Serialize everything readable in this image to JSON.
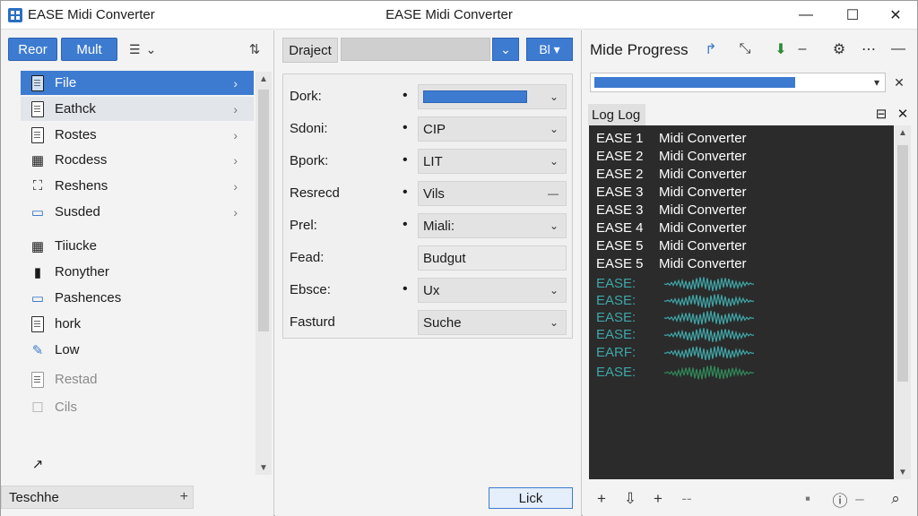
{
  "window": {
    "title_left": "EASE Midi Converter",
    "title_center": "EASE Midi Converter",
    "controls": {
      "minimize": "—",
      "maximize": "☐",
      "close": "✕"
    }
  },
  "left_panel": {
    "btn_1": "Reor",
    "btn_2": "Mult",
    "view_label": "☰",
    "view_caret": "⌄",
    "tree_icon": "⇅",
    "items": [
      {
        "label": "File",
        "icon": "doc-icon",
        "state": "selected",
        "chevron": true
      },
      {
        "label": "Eathck",
        "icon": "doc-icon",
        "state": "hover",
        "chevron": true
      },
      {
        "label": "Rostes",
        "icon": "doc-icon",
        "chevron": true
      },
      {
        "label": "Rocdess",
        "icon": "calendar-icon",
        "chevron": true
      },
      {
        "label": "Reshens",
        "icon": "network-icon",
        "chevron": true
      },
      {
        "label": "Susded",
        "icon": "monitor-icon",
        "chevron": true
      },
      {
        "label": "Tiiucke",
        "icon": "grid-icon"
      },
      {
        "label": "Ronyther",
        "icon": "bookmark-icon"
      },
      {
        "label": "Pashences",
        "icon": "screen-icon"
      },
      {
        "label": "hork",
        "icon": "doc-icon"
      },
      {
        "label": "Low",
        "icon": "pin-icon"
      },
      {
        "label": "Restad",
        "icon": "doc-icon",
        "state": "disabled"
      },
      {
        "label": "Cils",
        "icon": "checkbox-icon",
        "state": "disabled"
      }
    ],
    "footer_label": "Teschhe",
    "footer_plus": "+"
  },
  "middle_panel": {
    "tab_label": "Draject",
    "drop_1": "⌄",
    "drop_2": "Bl ▾",
    "props": [
      {
        "label": "Dork:",
        "value": "",
        "type": "blue"
      },
      {
        "label": "Sdoni:",
        "value": "CIP",
        "type": "select"
      },
      {
        "label": "Bpork:",
        "value": "LIT",
        "type": "select"
      },
      {
        "label": "Resrecd",
        "value": "Vils",
        "type": "minus"
      },
      {
        "label": "Prel:",
        "value": "Miali:",
        "type": "select"
      },
      {
        "label": "Fead:",
        "value": "Budgut",
        "type": "plain"
      },
      {
        "label": "Ebsce:",
        "value": "Ux",
        "type": "select"
      },
      {
        "label": "Fasturd",
        "value": "Suche",
        "type": "select"
      }
    ],
    "button": "Lick"
  },
  "right_panel": {
    "title": "Mide Progress",
    "progress": 0.7,
    "log_tab": "Log Log",
    "log_lines": [
      {
        "key": "EASE 1",
        "text": "Midi Converter"
      },
      {
        "key": "EASE 2",
        "text": "Midi Converter"
      },
      {
        "key": "EASE 2",
        "text": "Midi Converter"
      },
      {
        "key": "EASE 3",
        "text": "Midi Converter"
      },
      {
        "key": "EASE 3",
        "text": "Midi Converter"
      },
      {
        "key": "EASE 4",
        "text": "Midi Converter"
      },
      {
        "key": "EASE 5",
        "text": "Midi Converter"
      },
      {
        "key": "EASE 5",
        "text": "Midi Converter"
      }
    ],
    "wave_lines": [
      "EASE:",
      "EASE:",
      "EASE:",
      "EASE:",
      "EARF:",
      "EASE:"
    ],
    "colors": {
      "accent": "#3d7bd1",
      "log_bg": "#2b2b2b",
      "wave": "#3fa6a8"
    }
  }
}
